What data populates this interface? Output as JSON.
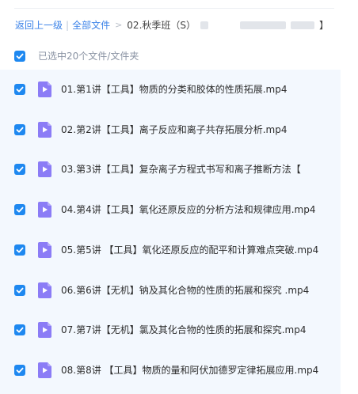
{
  "breadcrumb": {
    "back": "返回上一级",
    "separator": "|",
    "all_files": "全部文件",
    "arrow": ">",
    "current": "02.秋季班（S）",
    "current_tail": "】"
  },
  "selection": {
    "label": "已选中20个文件/文件夹",
    "checked": true
  },
  "colors": {
    "accent": "#1e88f0",
    "link": "#3c83e8",
    "video_icon": "#8b7cf6",
    "list_bg": "#f3f8fe"
  },
  "files": [
    {
      "name": "01.第1讲【工具】物质的分类和胶体的性质拓展.mp4",
      "icon": "video-file-icon",
      "checked": true
    },
    {
      "name": "02.第2讲【工具】离子反应和离子共存拓展分析.mp4",
      "icon": "video-file-icon",
      "checked": true
    },
    {
      "name": "03.第3讲【工具】复杂离子方程式书写和离子推断方法【",
      "icon": "video-file-icon",
      "checked": true
    },
    {
      "name": "04.第4讲【工具】氧化还原反应的分析方法和规律应用.mp4",
      "icon": "video-file-icon",
      "checked": true
    },
    {
      "name": "05.第5讲 【工具】氧化还原反应的配平和计算难点突破.mp4",
      "icon": "video-file-icon",
      "checked": true
    },
    {
      "name": "06.第6讲【无机】钠及其化合物的性质的拓展和探究 .mp4",
      "icon": "video-file-icon",
      "checked": true
    },
    {
      "name": "07.第7讲【无机】氯及其化合物的性质的拓展和探究.mp4",
      "icon": "video-file-icon",
      "checked": true
    },
    {
      "name": "08.第8讲 【工具】物质的量和阿伏加德罗定律拓展应用.mp4",
      "icon": "video-file-icon",
      "checked": true
    }
  ]
}
